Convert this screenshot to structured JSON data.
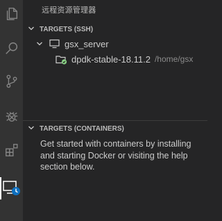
{
  "activity_bar": {
    "items": [
      {
        "icon": "files-icon"
      },
      {
        "icon": "search-icon"
      },
      {
        "icon": "source-control-icon"
      },
      {
        "icon": "debug-icon"
      },
      {
        "icon": "extensions-icon"
      },
      {
        "icon": "remote-explorer-icon",
        "active": true
      }
    ]
  },
  "sidebar": {
    "title": "远程资源管理器",
    "ssh_section": {
      "header": "TARGETS (SSH)",
      "host": {
        "label": "gsx_server"
      },
      "folder": {
        "label": "dpdk-stable-18.11.2",
        "path": "/home/gsx"
      }
    },
    "containers_section": {
      "header": "TARGETS (CONTAINERS)",
      "message": "Get started with containers by installing and starting Docker or visiting the help section below."
    }
  },
  "colors": {
    "activity_bar_bg": "#333333",
    "sidebar_bg": "#252526",
    "badge_blue": "#0e70c0",
    "connected_green": "#89d185"
  }
}
